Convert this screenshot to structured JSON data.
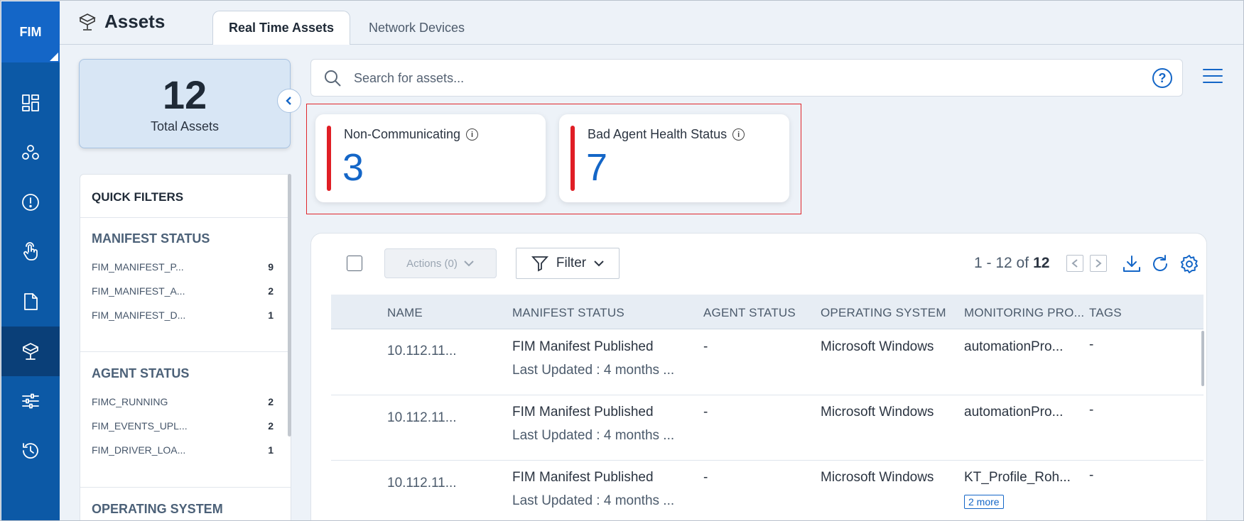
{
  "nav": {
    "brand": "FIM",
    "items": [
      {
        "icon": "dashboard-icon"
      },
      {
        "icon": "clusters-icon"
      },
      {
        "icon": "alert-icon"
      },
      {
        "icon": "touch-icon"
      },
      {
        "icon": "document-icon"
      },
      {
        "icon": "assets-icon",
        "active": true
      },
      {
        "icon": "sliders-icon"
      },
      {
        "icon": "history-icon"
      }
    ]
  },
  "header": {
    "title": "Assets",
    "tabs": [
      {
        "label": "Real Time Assets",
        "active": true
      },
      {
        "label": "Network Devices",
        "active": false
      }
    ]
  },
  "summary": {
    "total_value": "12",
    "total_label": "Total Assets"
  },
  "quick_filters": {
    "title": "QUICK FILTERS",
    "sections": [
      {
        "title": "MANIFEST STATUS",
        "items": [
          {
            "label": "FIM_MANIFEST_P...",
            "count": "9"
          },
          {
            "label": "FIM_MANIFEST_A...",
            "count": "2"
          },
          {
            "label": "FIM_MANIFEST_D...",
            "count": "1"
          }
        ]
      },
      {
        "title": "AGENT STATUS",
        "items": [
          {
            "label": "FIMC_RUNNING",
            "count": "2"
          },
          {
            "label": "FIM_EVENTS_UPL...",
            "count": "2"
          },
          {
            "label": "FIM_DRIVER_LOA...",
            "count": "1"
          }
        ]
      },
      {
        "title": "OPERATING SYSTEM",
        "items": []
      }
    ]
  },
  "search": {
    "placeholder": "Search for assets...",
    "help_glyph": "?"
  },
  "stats": [
    {
      "label": "Non-Communicating",
      "value": "3"
    },
    {
      "label": "Bad Agent Health Status",
      "value": "7"
    }
  ],
  "toolbar": {
    "actions_label": "Actions (0)",
    "filter_label": "Filter",
    "pager_range": "1 - 12 of",
    "pager_total": "12"
  },
  "table": {
    "columns": [
      "NAME",
      "MANIFEST STATUS",
      "AGENT STATUS",
      "OPERATING SYSTEM",
      "MONITORING PRO...",
      "TAGS"
    ],
    "rows": [
      {
        "name": "10.112.11...",
        "manifest": "FIM Manifest Published",
        "updated": "Last Updated : 4 months ...",
        "agent": "-",
        "os": "Microsoft Windows",
        "profile": "automationPro...",
        "more": "",
        "tags": "-"
      },
      {
        "name": "10.112.11...",
        "manifest": "FIM Manifest Published",
        "updated": "Last Updated : 4 months ...",
        "agent": "-",
        "os": "Microsoft Windows",
        "profile": "automationPro...",
        "more": "",
        "tags": "-"
      },
      {
        "name": "10.112.11...",
        "manifest": "FIM Manifest Published",
        "updated": "Last Updated : 4 months ...",
        "agent": "-",
        "os": "Microsoft Windows",
        "profile": "KT_Profile_Roh...",
        "more": "2 more",
        "tags": "-"
      }
    ]
  },
  "colors": {
    "nav_bg": "#0c59a6",
    "brand_bg": "#1466c7",
    "accent": "#1466c7",
    "alert_red": "#e01e25"
  }
}
